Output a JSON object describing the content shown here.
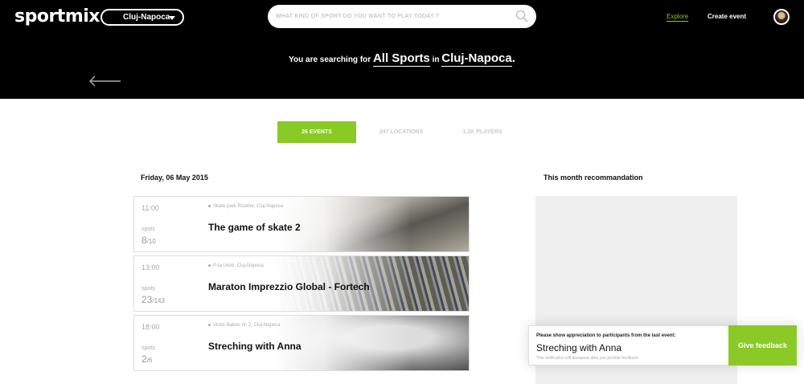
{
  "header": {
    "logo": "sportmix",
    "city": "Cluj-Napoca",
    "search_placeholder": "WHAT KIND OF SPORT DO YOU WANT TO PLAY TODAY ?",
    "nav": {
      "explore": "Explore",
      "create_event": "Create event"
    },
    "search_prefix": "You are searching for",
    "search_sport": "All Sports",
    "search_in": "in",
    "search_city": "Cluj-Napoca",
    "search_period": "."
  },
  "tabs": {
    "events": "26 EVENTS",
    "locations": "247 LOCATIONS",
    "players": "1.2K PLAYERS",
    "active": "events"
  },
  "events_section": {
    "date": "Friday, 06 May 2015",
    "spots_label": "spots",
    "items": [
      {
        "time": "11:00",
        "location": "Skate park Rozelor, Cluj-Napoca",
        "title": "The game of skate 2",
        "spots": "8",
        "capacity": "/10"
      },
      {
        "time": "13:00",
        "location": "P-ta Unirii, Cluj-Napoca",
        "title": "Maraton Imprezzio Global - Fortech",
        "spots": "23",
        "capacity": "/143"
      },
      {
        "time": "18:00",
        "location": "Victor Babes nr. 2, Cluj-Napoca",
        "title": "Streching with Anna",
        "spots": "2",
        "capacity": "/6"
      }
    ]
  },
  "recommendation": {
    "heading": "This month recommandation"
  },
  "feedback_toast": {
    "prompt": "Please show appreciation to participants from the last event:",
    "event": "Streching with Anna",
    "note": "This notification will dissapear after you provide feedback.",
    "button": "Give feedback"
  },
  "colors": {
    "accent": "#8ac926",
    "header_bg": "#000000",
    "panel_bg": "#efefef"
  }
}
